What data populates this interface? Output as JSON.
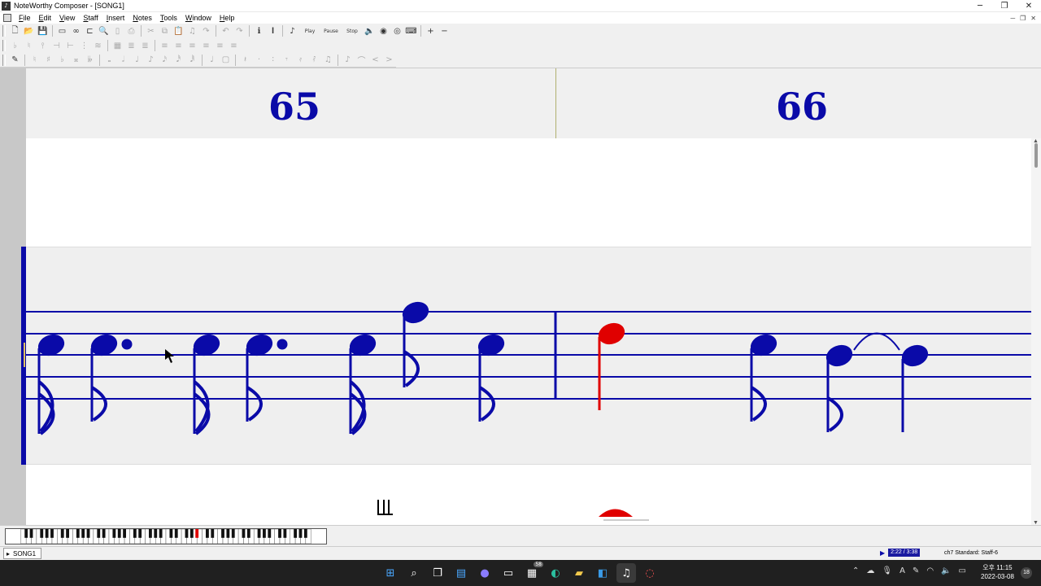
{
  "window": {
    "title": "NoteWorthy Composer - [SONG1]",
    "minimize": "─",
    "restore": "❐",
    "close": "✕"
  },
  "menu": [
    "File",
    "Edit",
    "View",
    "Staff",
    "Insert",
    "Notes",
    "Tools",
    "Window",
    "Help"
  ],
  "toolbar1": {
    "play_label": "Play",
    "pause_label": "Pause",
    "stop_label": "Stop"
  },
  "score": {
    "measure_numbers": [
      "65",
      "66"
    ],
    "current_note_color": "#e00000",
    "note_color": "#0a0aa8"
  },
  "status": {
    "document_tab": "SONG1",
    "playback_time": "2:22 / 3:38",
    "staff_info": "ch7 Standard: Staff-6"
  },
  "taskbar": {
    "clock_ampm": "오후 11:15",
    "date": "2022-03-08",
    "badge": "58",
    "notif_count": "18",
    "input_mode": "A"
  }
}
